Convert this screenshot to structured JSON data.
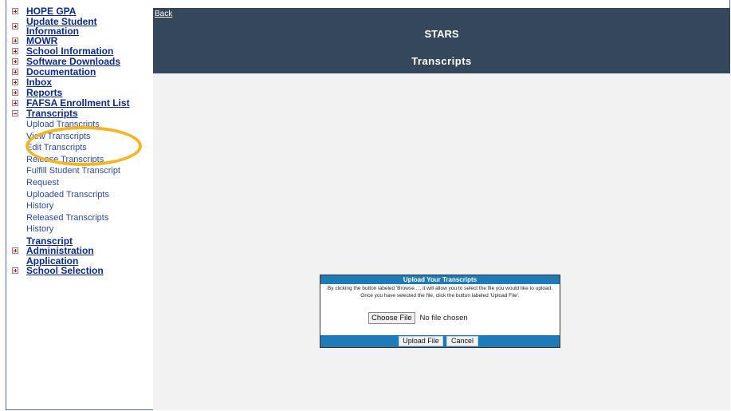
{
  "sidebar": {
    "items": [
      {
        "label": "HOPE GPA"
      },
      {
        "label": "Update Student Information"
      },
      {
        "label": "MOWR"
      },
      {
        "label": "School Information"
      },
      {
        "label": "Software Downloads"
      },
      {
        "label": "Documentation"
      },
      {
        "label": "Inbox"
      },
      {
        "label": "Reports"
      },
      {
        "label": "FAFSA Enrollment List"
      },
      {
        "label": "Transcripts"
      }
    ],
    "transcripts_sub": [
      "Upload Transcripts",
      "View Transcripts",
      "Edit Transcripts",
      "Release Transcripts",
      "Fulfill Student Transcript Request",
      "Uploaded Transcripts History",
      "Released Transcripts History"
    ],
    "after_items": [
      {
        "label": "Transcript"
      },
      {
        "label": "Administration"
      },
      {
        "label": "Application"
      },
      {
        "label": "School Selection"
      }
    ]
  },
  "header": {
    "back": "Back",
    "title": "STARS",
    "subtitle": "Transcripts"
  },
  "dialog": {
    "title": "Upload Your Transcripts",
    "instructions": "By clicking the button labeled 'Browse...', it will allow you to select the file you would like to upload.  Once you have selected the file, click the button labeled 'Upload File'.",
    "choose_file": "Choose File",
    "no_file": "No file chosen",
    "upload_button": "Upload File",
    "cancel_button": "Cancel"
  },
  "colors": {
    "header_bg": "#35475a",
    "dialog_accent": "#1f7ab8",
    "link": "#0b2a8a",
    "highlight": "#f4b521"
  }
}
